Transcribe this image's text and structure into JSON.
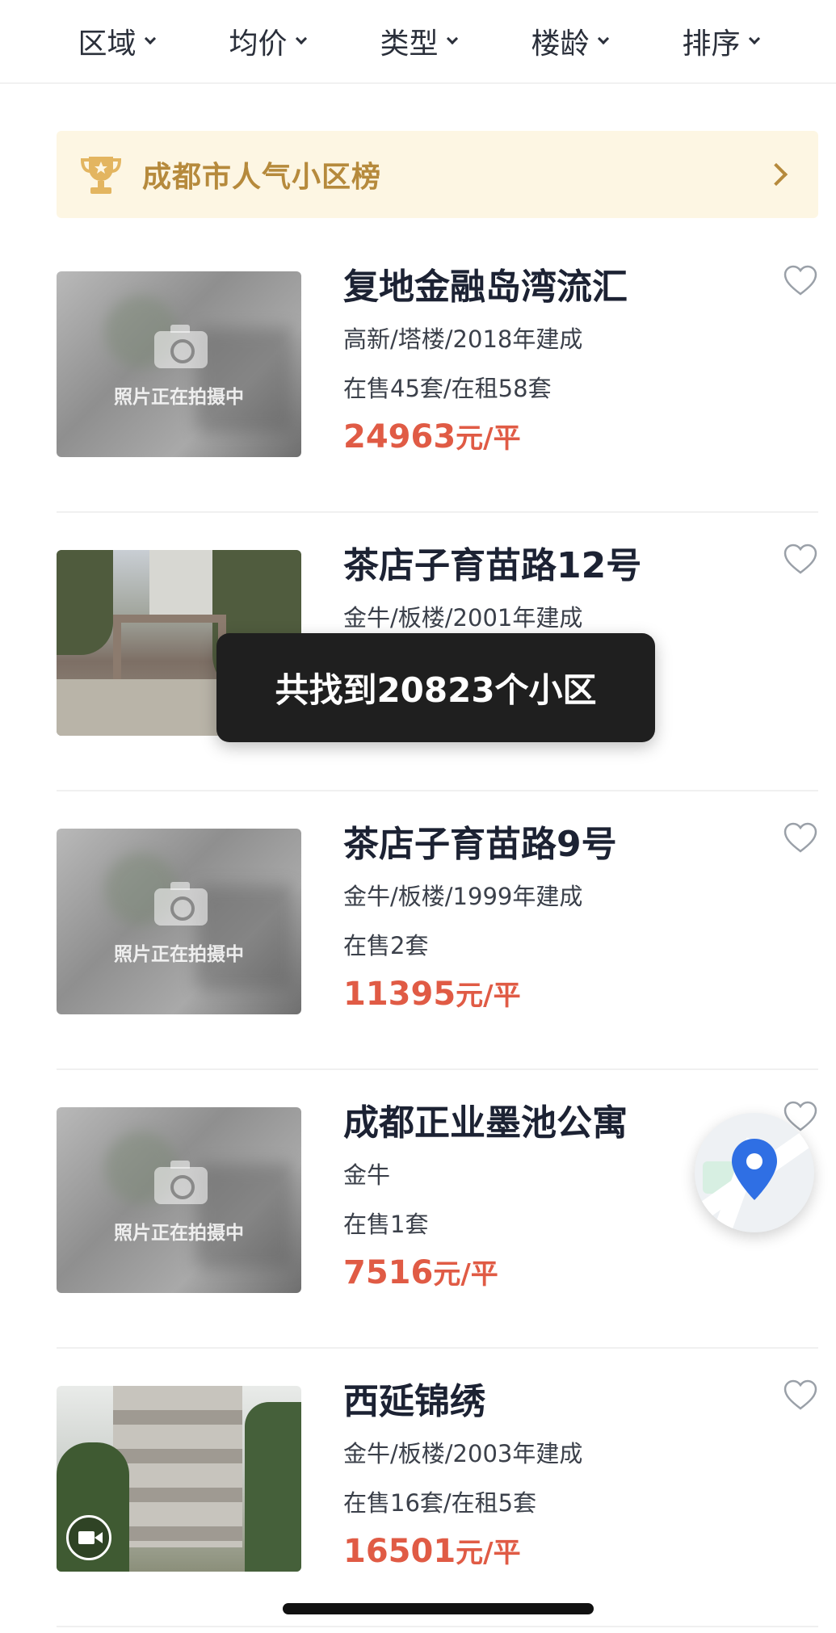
{
  "filters": [
    {
      "label": "区域"
    },
    {
      "label": "均价"
    },
    {
      "label": "类型"
    },
    {
      "label": "楼龄"
    },
    {
      "label": "排序"
    }
  ],
  "ranking_banner": {
    "label": "成都市人气小区榜",
    "icon": "trophy-icon"
  },
  "placeholder_text": "照片正在拍摄中",
  "listings": [
    {
      "name": "复地金融岛湾流汇",
      "meta": "高新/塔楼/2018年建成",
      "stock": "在售45套/在租58套",
      "price": "24963",
      "unit": "元/平",
      "image": "placeholder"
    },
    {
      "name": "茶店子育苗路12号",
      "meta": "金牛/板楼/2001年建成",
      "stock": "",
      "price": "",
      "unit": "",
      "image": "photo-gate"
    },
    {
      "name": "茶店子育苗路9号",
      "meta": "金牛/板楼/1999年建成",
      "stock": "在售2套",
      "price": "11395",
      "unit": "元/平",
      "image": "placeholder"
    },
    {
      "name": "成都正业墨池公寓",
      "meta": "金牛",
      "stock": "在售1套",
      "price": "7516",
      "unit": "元/平",
      "image": "placeholder"
    },
    {
      "name": "西延锦绣",
      "meta": "金牛/板楼/2003年建成",
      "stock": "在售16套/在租5套",
      "price": "16501",
      "unit": "元/平",
      "image": "photo-building",
      "video": true
    }
  ],
  "toast": {
    "text": "共找到20823个小区"
  },
  "colors": {
    "accent_price": "#e05b45",
    "banner_bg": "#fdf6e3",
    "banner_text": "#b68a3c",
    "map_pin": "#2f6fe4"
  }
}
